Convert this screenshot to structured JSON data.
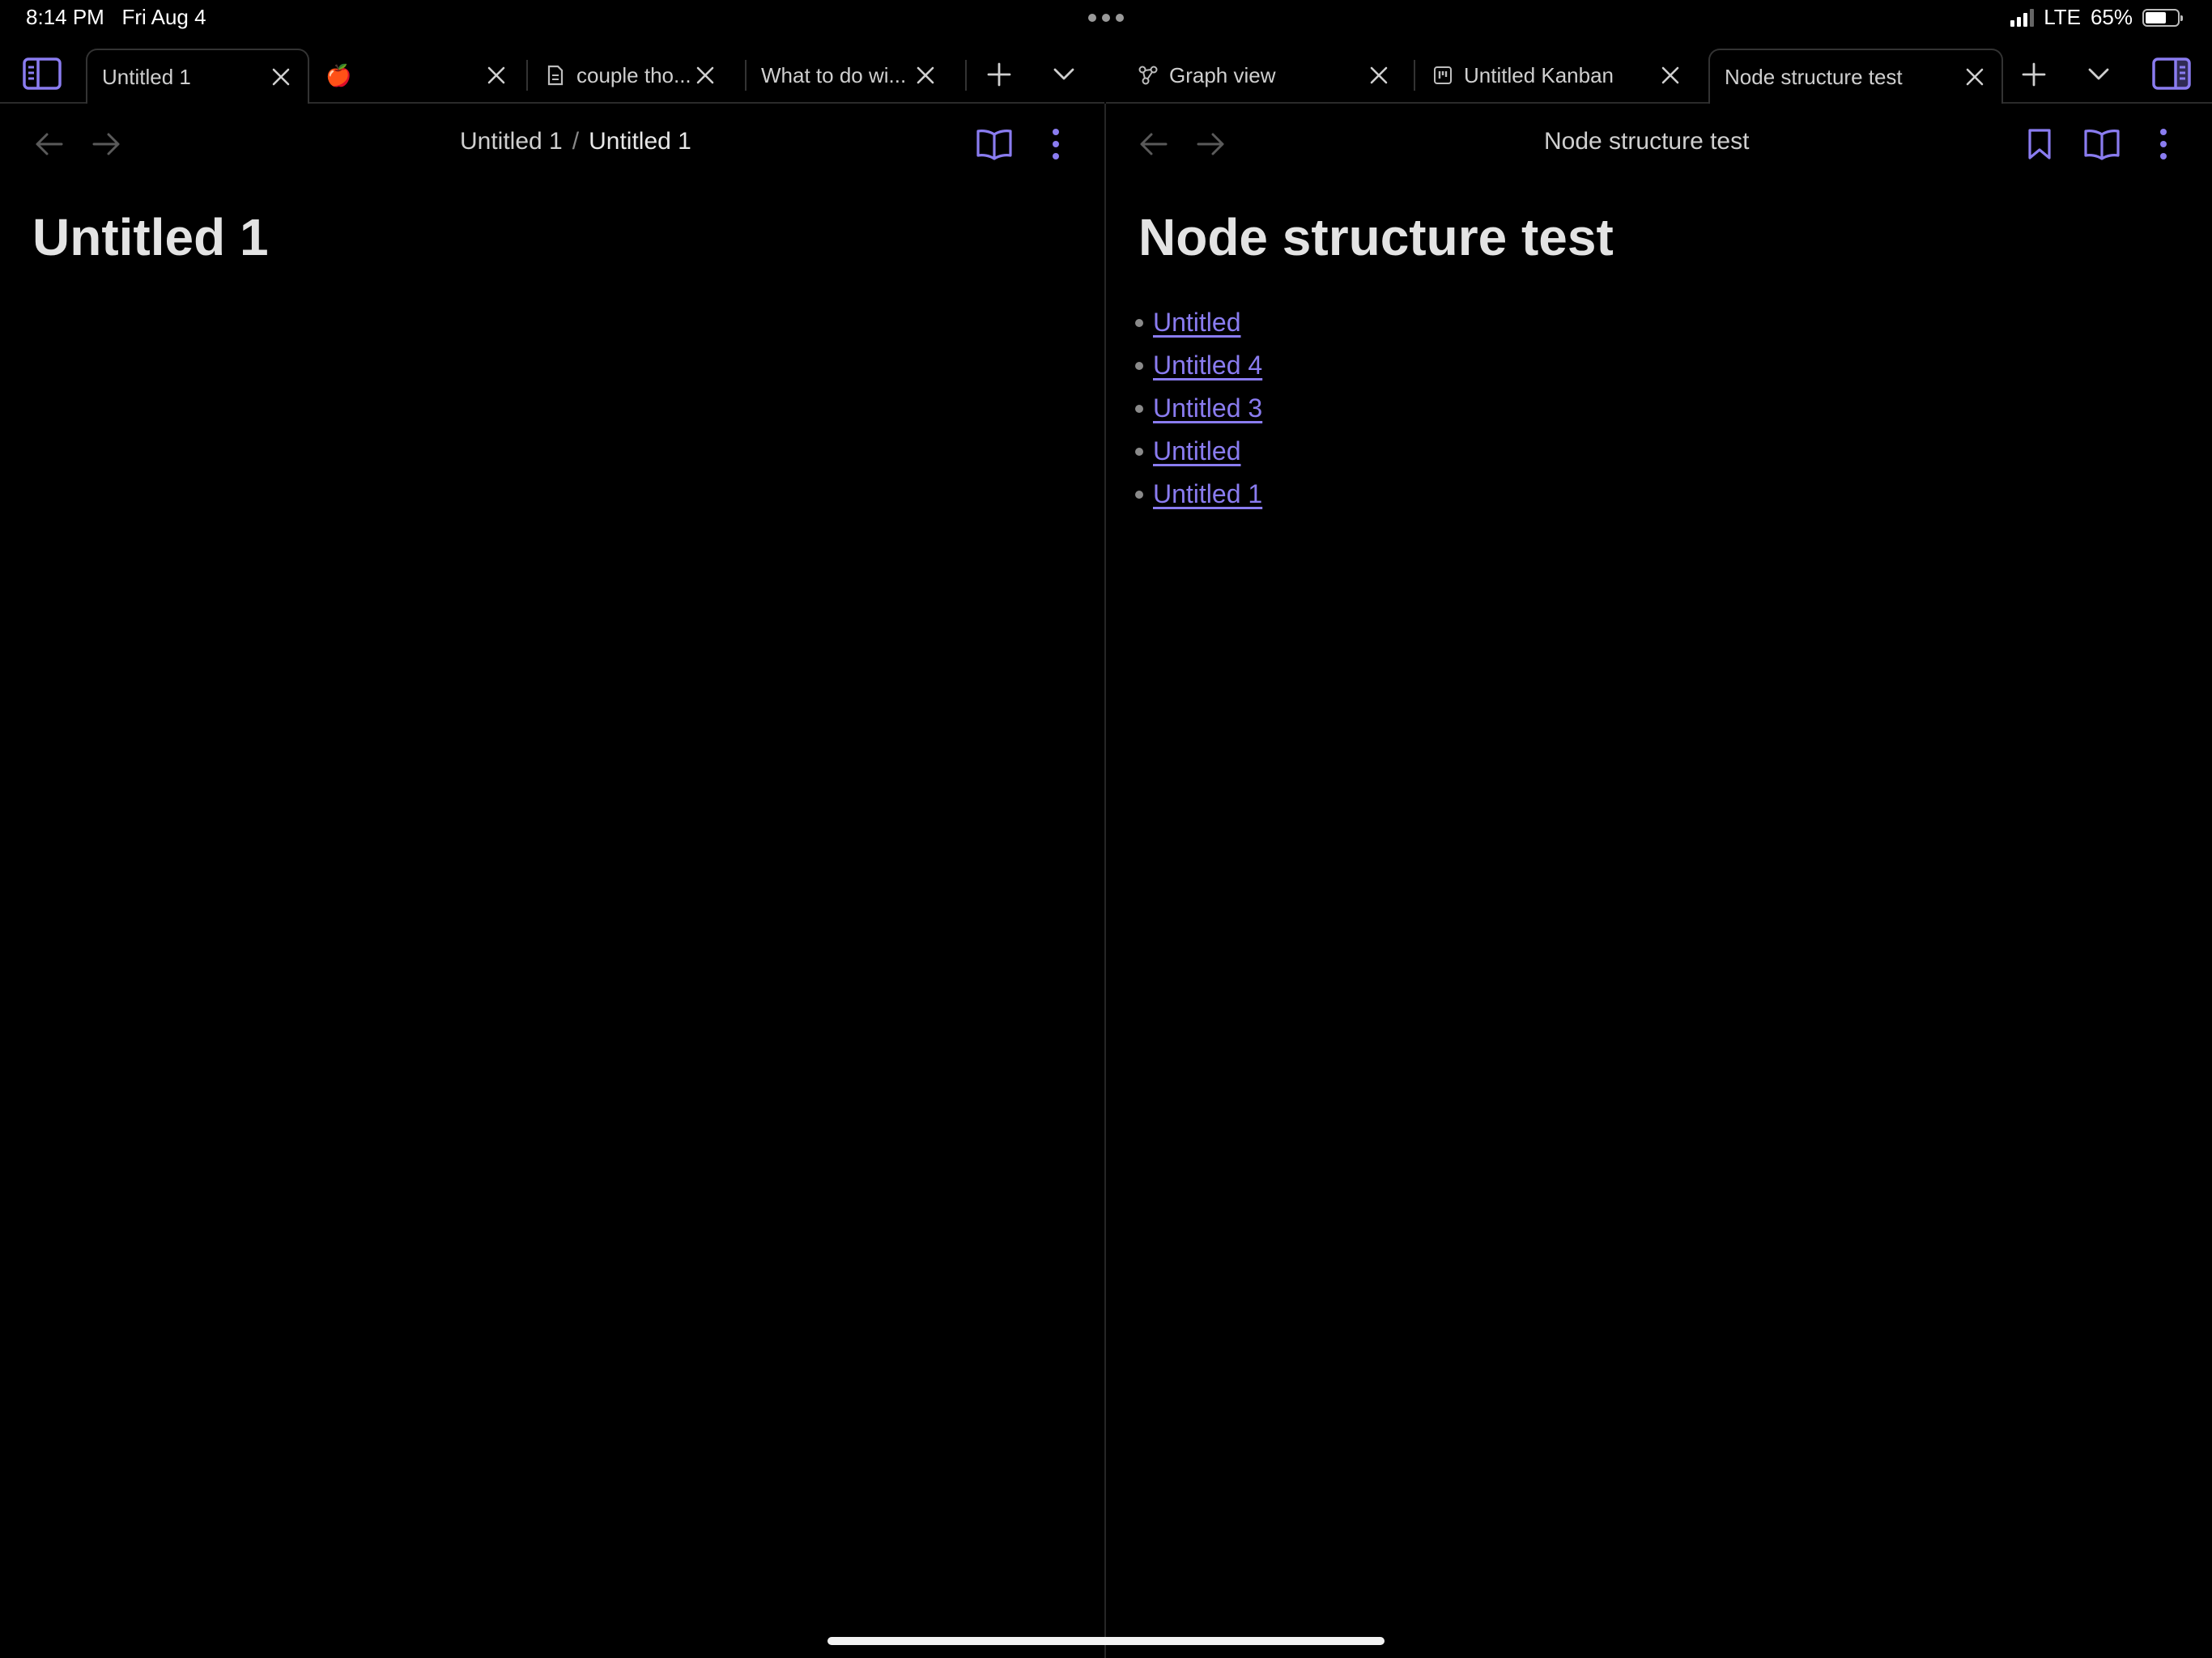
{
  "status": {
    "time": "8:14 PM",
    "date": "Fri Aug 4",
    "network": "LTE",
    "battery": "65%",
    "battery_level": 0.65
  },
  "left_tabs": [
    {
      "label": "Untitled 1",
      "active": true,
      "icon": ""
    },
    {
      "label": "🍎",
      "active": false,
      "icon": ""
    },
    {
      "label": "couple tho...",
      "active": false,
      "icon": "document-icon"
    },
    {
      "label": "What to do wi...",
      "active": false,
      "icon": ""
    }
  ],
  "right_tabs": [
    {
      "label": "Graph view",
      "active": false,
      "icon": "graph-icon"
    },
    {
      "label": "Untitled Kanban",
      "active": false,
      "icon": "kanban-icon"
    },
    {
      "label": "Node structure test",
      "active": true,
      "icon": ""
    }
  ],
  "left_pane": {
    "breadcrumb_parent": "Untitled 1",
    "breadcrumb_separator": "/",
    "breadcrumb_current": "Untitled 1",
    "heading": "Untitled 1"
  },
  "right_pane": {
    "view_title": "Node structure test",
    "heading": "Node structure test",
    "links": [
      "Untitled",
      "Untitled 4",
      "Untitled 3",
      "Untitled",
      "Untitled 1"
    ]
  },
  "colors": {
    "accent": "#8a7cf0",
    "background": "#000000",
    "text": "#dcdcdc"
  }
}
